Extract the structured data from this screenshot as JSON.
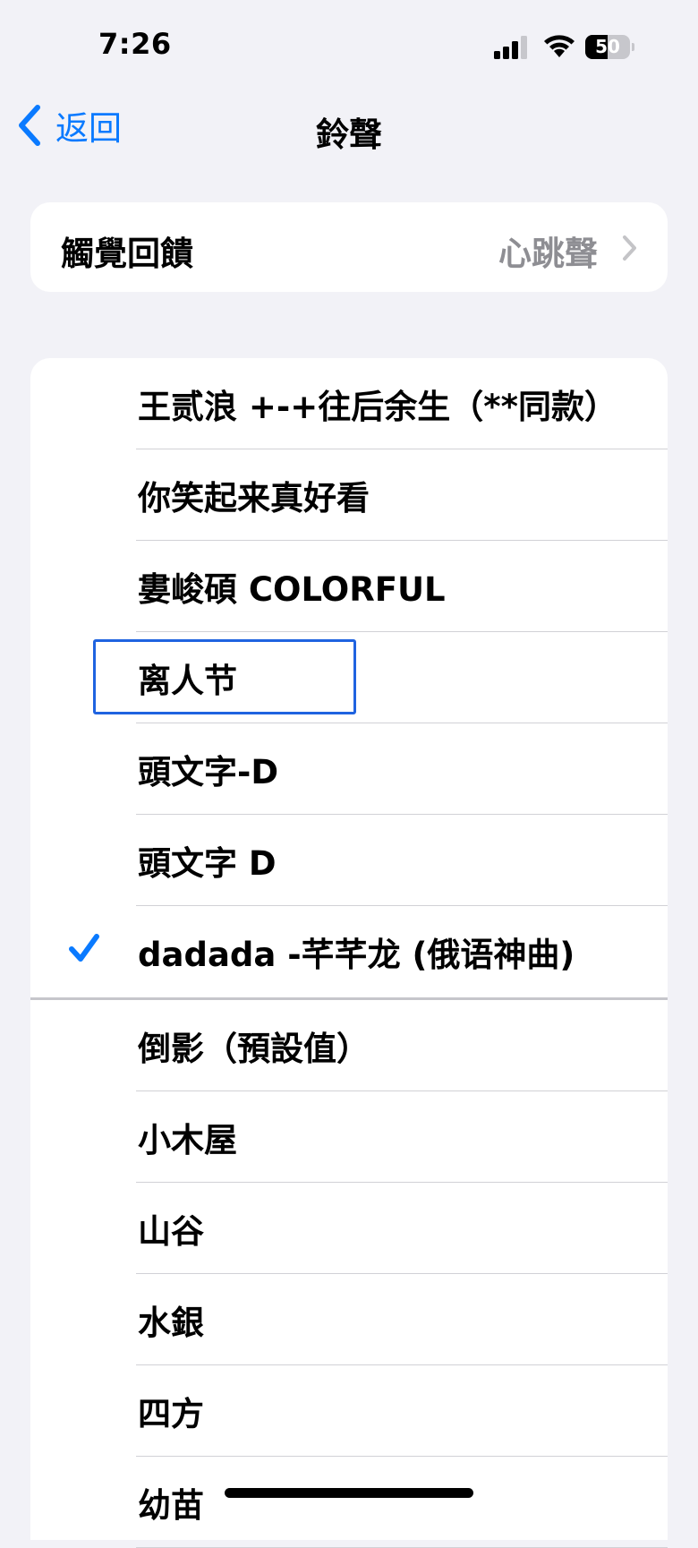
{
  "status_bar": {
    "time": "7:26",
    "battery_level": "50",
    "battery_fraction": 0.5
  },
  "nav": {
    "back_label": "返回",
    "title": "鈴聲"
  },
  "haptics": {
    "label": "觸覺回饋",
    "value": "心跳聲"
  },
  "ringtones": {
    "custom": [
      {
        "label": "王贰浪 +-+往后余生（**同款）",
        "selected": false
      },
      {
        "label": "你笑起来真好看",
        "selected": false
      },
      {
        "label": "婁峻碩 COLORFUL",
        "selected": false
      },
      {
        "label": "离人节",
        "selected": false,
        "highlighted": true
      },
      {
        "label": "頭文字-D",
        "selected": false
      },
      {
        "label": "頭文字 D",
        "selected": false
      },
      {
        "label": "dadada -芊芊龙 (俄语神曲)",
        "selected": true
      }
    ],
    "builtin": [
      {
        "label": "倒影（預設值）",
        "selected": false
      },
      {
        "label": "小木屋",
        "selected": false
      },
      {
        "label": "山谷",
        "selected": false
      },
      {
        "label": "水銀",
        "selected": false
      },
      {
        "label": "四方",
        "selected": false
      },
      {
        "label": "幼苗",
        "selected": false
      }
    ]
  },
  "colors": {
    "accent": "#0A7AFF",
    "background": "#F2F2F7",
    "secondary_text": "#8E8E93",
    "highlight_box": "#1F63E0"
  },
  "icons": {
    "back": "chevron-left-icon",
    "disclosure": "chevron-right-icon",
    "selected": "checkmark-icon",
    "signal": "cellular-signal-icon",
    "wifi": "wifi-icon",
    "battery": "battery-icon"
  }
}
